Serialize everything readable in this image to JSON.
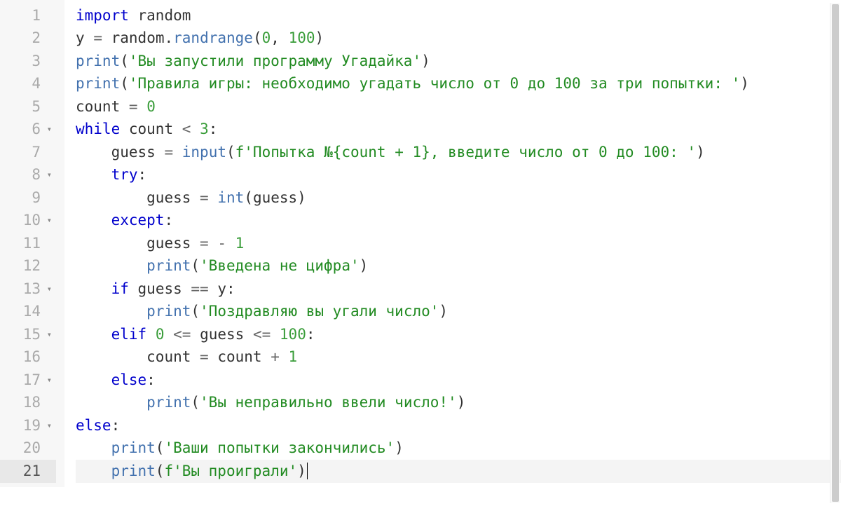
{
  "editor": {
    "language": "python",
    "active_line": 21,
    "lines": [
      {
        "n": 1,
        "fold": false,
        "tokens": [
          [
            "kw",
            "import"
          ],
          [
            "sp",
            " "
          ],
          [
            "id",
            "random"
          ]
        ]
      },
      {
        "n": 2,
        "fold": false,
        "tokens": [
          [
            "id",
            "y"
          ],
          [
            "sp",
            " "
          ],
          [
            "op",
            "="
          ],
          [
            "sp",
            " "
          ],
          [
            "id",
            "random"
          ],
          [
            "punc",
            "."
          ],
          [
            "fn",
            "randrange"
          ],
          [
            "punc",
            "("
          ],
          [
            "num",
            "0"
          ],
          [
            "punc",
            ","
          ],
          [
            "sp",
            " "
          ],
          [
            "num",
            "100"
          ],
          [
            "punc",
            ")"
          ]
        ]
      },
      {
        "n": 3,
        "fold": false,
        "tokens": [
          [
            "fn",
            "print"
          ],
          [
            "punc",
            "("
          ],
          [
            "str",
            "'Вы запустили программу Угадайка'"
          ],
          [
            "punc",
            ")"
          ]
        ]
      },
      {
        "n": 4,
        "fold": false,
        "tokens": [
          [
            "fn",
            "print"
          ],
          [
            "punc",
            "("
          ],
          [
            "str",
            "'Правила игры: необходимо угадать число от 0 до 100 за три попытки: '"
          ],
          [
            "punc",
            ")"
          ]
        ]
      },
      {
        "n": 5,
        "fold": false,
        "tokens": [
          [
            "id",
            "count"
          ],
          [
            "sp",
            " "
          ],
          [
            "op",
            "="
          ],
          [
            "sp",
            " "
          ],
          [
            "num",
            "0"
          ]
        ]
      },
      {
        "n": 6,
        "fold": true,
        "tokens": [
          [
            "kw",
            "while"
          ],
          [
            "sp",
            " "
          ],
          [
            "id",
            "count"
          ],
          [
            "sp",
            " "
          ],
          [
            "op",
            "<"
          ],
          [
            "sp",
            " "
          ],
          [
            "num",
            "3"
          ],
          [
            "punc",
            ":"
          ]
        ]
      },
      {
        "n": 7,
        "fold": false,
        "tokens": [
          [
            "sp",
            "    "
          ],
          [
            "id",
            "guess"
          ],
          [
            "sp",
            " "
          ],
          [
            "op",
            "="
          ],
          [
            "sp",
            " "
          ],
          [
            "fn",
            "input"
          ],
          [
            "punc",
            "("
          ],
          [
            "str",
            "f'Попытка №{count + 1}, введите число от 0 до 100: '"
          ],
          [
            "punc",
            ")"
          ]
        ]
      },
      {
        "n": 8,
        "fold": true,
        "tokens": [
          [
            "sp",
            "    "
          ],
          [
            "kw",
            "try"
          ],
          [
            "punc",
            ":"
          ]
        ]
      },
      {
        "n": 9,
        "fold": false,
        "tokens": [
          [
            "sp",
            "        "
          ],
          [
            "id",
            "guess"
          ],
          [
            "sp",
            " "
          ],
          [
            "op",
            "="
          ],
          [
            "sp",
            " "
          ],
          [
            "fn",
            "int"
          ],
          [
            "punc",
            "("
          ],
          [
            "id",
            "guess"
          ],
          [
            "punc",
            ")"
          ]
        ]
      },
      {
        "n": 10,
        "fold": true,
        "tokens": [
          [
            "sp",
            "    "
          ],
          [
            "kw",
            "except"
          ],
          [
            "punc",
            ":"
          ]
        ]
      },
      {
        "n": 11,
        "fold": false,
        "tokens": [
          [
            "sp",
            "        "
          ],
          [
            "id",
            "guess"
          ],
          [
            "sp",
            " "
          ],
          [
            "op",
            "="
          ],
          [
            "sp",
            " "
          ],
          [
            "op",
            "-"
          ],
          [
            "sp",
            " "
          ],
          [
            "num",
            "1"
          ]
        ]
      },
      {
        "n": 12,
        "fold": false,
        "tokens": [
          [
            "sp",
            "        "
          ],
          [
            "fn",
            "print"
          ],
          [
            "punc",
            "("
          ],
          [
            "str",
            "'Введена не цифра'"
          ],
          [
            "punc",
            ")"
          ]
        ]
      },
      {
        "n": 13,
        "fold": true,
        "tokens": [
          [
            "sp",
            "    "
          ],
          [
            "kw",
            "if"
          ],
          [
            "sp",
            " "
          ],
          [
            "id",
            "guess"
          ],
          [
            "sp",
            " "
          ],
          [
            "op",
            "=="
          ],
          [
            "sp",
            " "
          ],
          [
            "id",
            "y"
          ],
          [
            "punc",
            ":"
          ]
        ]
      },
      {
        "n": 14,
        "fold": false,
        "tokens": [
          [
            "sp",
            "        "
          ],
          [
            "fn",
            "print"
          ],
          [
            "punc",
            "("
          ],
          [
            "str",
            "'Поздравляю вы угали число'"
          ],
          [
            "punc",
            ")"
          ]
        ]
      },
      {
        "n": 15,
        "fold": true,
        "tokens": [
          [
            "sp",
            "    "
          ],
          [
            "kw",
            "elif"
          ],
          [
            "sp",
            " "
          ],
          [
            "num",
            "0"
          ],
          [
            "sp",
            " "
          ],
          [
            "op",
            "<="
          ],
          [
            "sp",
            " "
          ],
          [
            "id",
            "guess"
          ],
          [
            "sp",
            " "
          ],
          [
            "op",
            "<="
          ],
          [
            "sp",
            " "
          ],
          [
            "num",
            "100"
          ],
          [
            "punc",
            ":"
          ]
        ]
      },
      {
        "n": 16,
        "fold": false,
        "tokens": [
          [
            "sp",
            "        "
          ],
          [
            "id",
            "count"
          ],
          [
            "sp",
            " "
          ],
          [
            "op",
            "="
          ],
          [
            "sp",
            " "
          ],
          [
            "id",
            "count"
          ],
          [
            "sp",
            " "
          ],
          [
            "op",
            "+"
          ],
          [
            "sp",
            " "
          ],
          [
            "num",
            "1"
          ]
        ]
      },
      {
        "n": 17,
        "fold": true,
        "tokens": [
          [
            "sp",
            "    "
          ],
          [
            "kw",
            "else"
          ],
          [
            "punc",
            ":"
          ]
        ]
      },
      {
        "n": 18,
        "fold": false,
        "tokens": [
          [
            "sp",
            "        "
          ],
          [
            "fn",
            "print"
          ],
          [
            "punc",
            "("
          ],
          [
            "str",
            "'Вы неправильно ввели число!'"
          ],
          [
            "punc",
            ")"
          ]
        ]
      },
      {
        "n": 19,
        "fold": true,
        "tokens": [
          [
            "kw",
            "else"
          ],
          [
            "punc",
            ":"
          ]
        ]
      },
      {
        "n": 20,
        "fold": false,
        "tokens": [
          [
            "sp",
            "    "
          ],
          [
            "fn",
            "print"
          ],
          [
            "punc",
            "("
          ],
          [
            "str",
            "'Ваши попытки закончились'"
          ],
          [
            "punc",
            ")"
          ]
        ]
      },
      {
        "n": 21,
        "fold": false,
        "tokens": [
          [
            "sp",
            "    "
          ],
          [
            "fn",
            "print"
          ],
          [
            "punc",
            "("
          ],
          [
            "str",
            "f'Вы проиграли'"
          ],
          [
            "punc",
            ")"
          ],
          [
            "cursor",
            ""
          ]
        ]
      }
    ]
  },
  "labels": {
    "fold_glyph": "▾"
  }
}
